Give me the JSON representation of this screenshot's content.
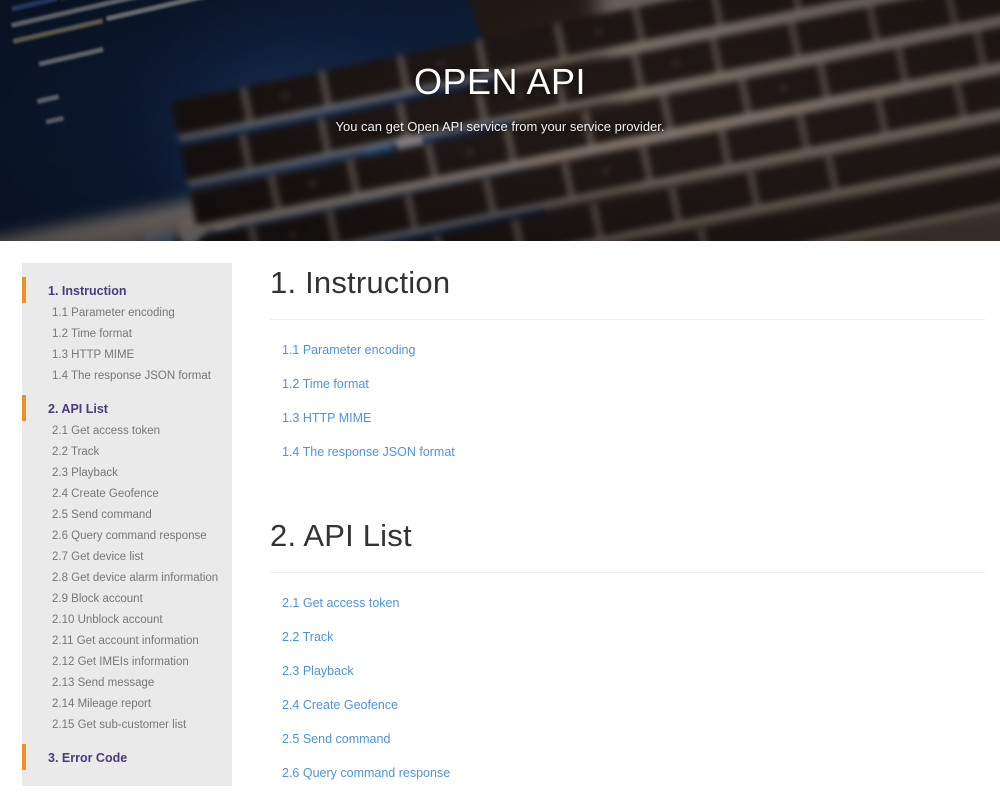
{
  "hero": {
    "title": "OPEN API",
    "subtitle": "You can get Open API service from your service provider.",
    "background_image": "laptop-keyboard-code-photo"
  },
  "colors": {
    "accent_orange": "#ef9120",
    "sidebar_bg": "#eaeaea",
    "sidebar_heading": "#4b3a80",
    "sidebar_item": "#777777",
    "link_blue": "#4f94d9",
    "heading_text": "#333333",
    "rule": "#eeeeee"
  },
  "sidebar": {
    "sections": [
      {
        "label": "1. Instruction",
        "items": [
          "1.1 Parameter encoding",
          "1.2 Time format",
          "1.3 HTTP MIME",
          "1.4 The response JSON format"
        ]
      },
      {
        "label": "2. API List",
        "items": [
          "2.1 Get access token",
          "2.2 Track",
          "2.3 Playback",
          "2.4 Create Geofence",
          "2.5 Send command",
          "2.6 Query command response",
          "2.7 Get device list",
          "2.8 Get device alarm information",
          "2.9 Block account",
          "2.10 Unblock account",
          "2.11 Get account information",
          "2.12 Get IMEIs information",
          "2.13 Send message",
          "2.14 Mileage report",
          "2.15 Get sub-customer list"
        ]
      },
      {
        "label": "3. Error Code",
        "items": []
      }
    ]
  },
  "content": {
    "sections": [
      {
        "heading": "1. Instruction",
        "links": [
          "1.1 Parameter encoding",
          "1.2 Time format",
          "1.3 HTTP MIME",
          "1.4 The response JSON format"
        ]
      },
      {
        "heading": "2. API List",
        "links": [
          "2.1 Get access token",
          "2.2 Track",
          "2.3 Playback",
          "2.4 Create Geofence",
          "2.5 Send command",
          "2.6 Query command response"
        ]
      }
    ]
  }
}
